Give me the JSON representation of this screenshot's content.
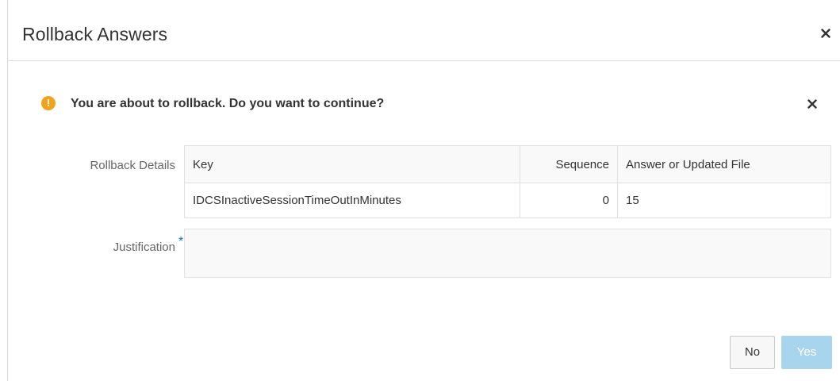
{
  "dialog": {
    "title": "Rollback Answers",
    "close_icon": "close-icon"
  },
  "warning": {
    "icon": "warning-icon",
    "icon_glyph": "!",
    "icon_color": "#f0a31c",
    "message": "You are about to rollback. Do you want to continue?",
    "dismiss_icon": "close-icon"
  },
  "form": {
    "rollback_details_label": "Rollback Details",
    "justification_label": "Justification",
    "required_marker": "*",
    "justification_value": "",
    "table": {
      "columns": [
        "Key",
        "Sequence",
        "Answer or Updated File"
      ],
      "rows": [
        {
          "key": "IDCSInactiveSessionTimeOutInMinutes",
          "sequence": "0",
          "answer": "15"
        }
      ]
    }
  },
  "footer": {
    "no_label": "No",
    "yes_label": "Yes",
    "yes_color": "#a8d4ee",
    "required_color": "#0572ce"
  }
}
